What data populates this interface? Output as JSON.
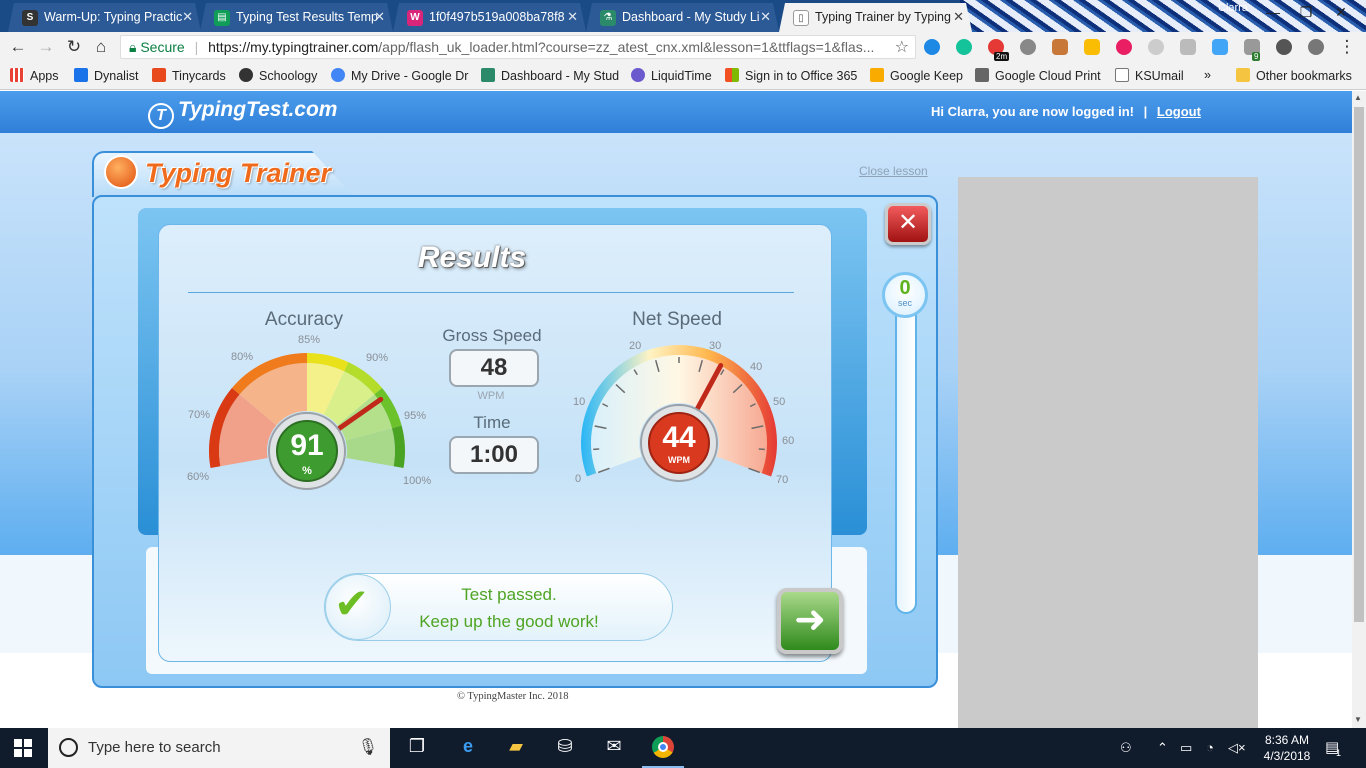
{
  "browser": {
    "tabs": [
      {
        "title": "Warm-Up: Typing Practic",
        "icon": "S",
        "color": "#333333"
      },
      {
        "title": "Typing Test Results Temp",
        "icon": "▤",
        "color": "#0f9d58"
      },
      {
        "title": "1f0f497b519a008ba78f8",
        "icon": "W",
        "color": "#d9267a"
      },
      {
        "title": "Dashboard - My Study Li",
        "icon": "⚗",
        "color": "#2a8a6a"
      },
      {
        "title": "Typing Trainer by Typing",
        "icon": "▯",
        "color": "#555555"
      }
    ],
    "user_name": "Clarra",
    "secure_label": "Secure",
    "url_host": "https://my.typingtrainer.com",
    "url_path": "/app/flash_uk_loader.html?course=zz_atest_cnx.xml&lesson=1&ttflags=1&flas...",
    "extension_badge": "2m",
    "extension_badge2": "9",
    "bookmarks": [
      {
        "label": "Apps",
        "color": "#e94235"
      },
      {
        "label": "Dynalist",
        "color": "#1a73e8"
      },
      {
        "label": "Tinycards",
        "color": "#e8491d"
      },
      {
        "label": "Schoology",
        "color": "#333333"
      },
      {
        "label": "My Drive - Google Dr",
        "color": "#4285f4"
      },
      {
        "label": "Dashboard - My Stud",
        "color": "#2a8a6a"
      },
      {
        "label": "LiquidTime",
        "color": "#6a5acd"
      },
      {
        "label": "Sign in to Office 365",
        "color": "#f25022"
      },
      {
        "label": "Google Keep",
        "color": "#f9ab00"
      },
      {
        "label": "Google Cloud Print",
        "color": "#666666"
      },
      {
        "label": "KSUmail",
        "color": "#555555"
      }
    ],
    "more_bookmarks": "»",
    "other_bookmarks": "Other bookmarks"
  },
  "site": {
    "logo_text": "TypingTest.com",
    "greeting": "Hi Clarra, you are now logged in!",
    "separator": "|",
    "logout": "Logout",
    "copyright": "© TypingMaster Inc. 2018"
  },
  "trainer": {
    "title": "Typing Trainer",
    "close_lesson": "Close lesson",
    "results_title": "Results",
    "timer": {
      "value": "0",
      "unit": "sec"
    },
    "accuracy": {
      "label": "Accuracy",
      "value": "91",
      "unit": "%",
      "value_num": 91,
      "scale": [
        "60%",
        "70%",
        "80%",
        "85%",
        "90%",
        "95%",
        "100%"
      ]
    },
    "gross_speed": {
      "label": "Gross Speed",
      "value": "48",
      "unit": "WPM"
    },
    "time": {
      "label": "Time",
      "value": "1:00"
    },
    "net_speed": {
      "label": "Net Speed",
      "value": "44",
      "unit": "WPM",
      "value_num": 44,
      "scale": [
        "0",
        "10",
        "20",
        "30",
        "40",
        "50",
        "60",
        "70"
      ]
    },
    "passed_line1": "Test passed.",
    "passed_line2": "Keep up the good work!"
  },
  "taskbar": {
    "search_placeholder": "Type here to search",
    "time": "8:36 AM",
    "date": "4/3/2018",
    "notifications": "1"
  },
  "colors": {
    "header_blue": "#2f7fd8",
    "accent_orange": "#f06a1b",
    "pass_green": "#4fa423"
  }
}
